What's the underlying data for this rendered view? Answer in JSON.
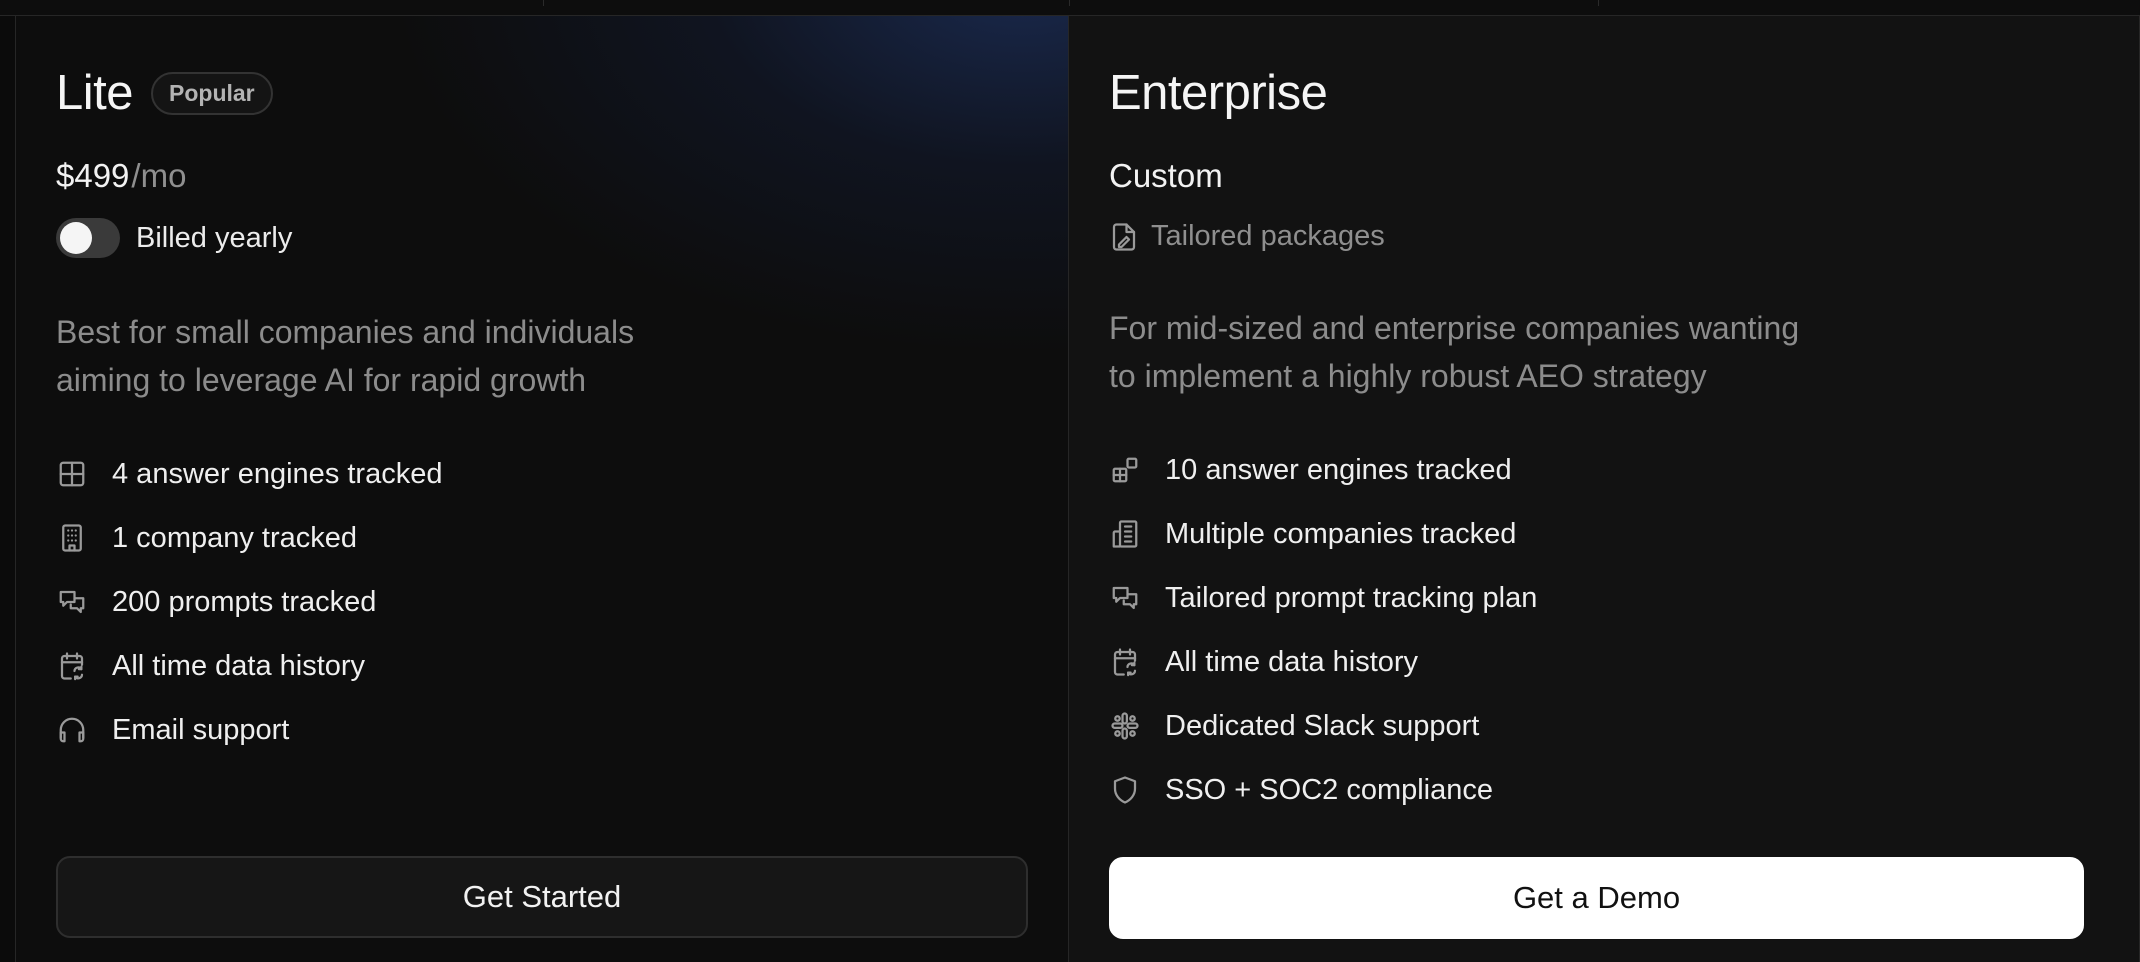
{
  "lite": {
    "title": "Lite",
    "badge": "Popular",
    "price": "$499",
    "period": "/mo",
    "toggle_label": "Billed yearly",
    "toggle_on": false,
    "description_line1": "Best for small companies and individuals",
    "description_line2": "aiming to leverage AI for rapid growth",
    "features": [
      {
        "icon": "grid-icon",
        "label": "4 answer engines tracked"
      },
      {
        "icon": "building-icon",
        "label": "1 company tracked"
      },
      {
        "icon": "chat-bubbles-icon",
        "label": "200 prompts tracked"
      },
      {
        "icon": "calendar-refresh-icon",
        "label": "All time data history"
      },
      {
        "icon": "headphones-icon",
        "label": "Email support"
      }
    ],
    "cta": "Get Started"
  },
  "enterprise": {
    "title": "Enterprise",
    "price": "Custom",
    "packages_label": "Tailored packages",
    "description_line1": "For mid-sized and enterprise companies wanting",
    "description_line2": "to implement a highly robust AEO strategy",
    "features": [
      {
        "icon": "grid-plus-icon",
        "label": "10 answer engines tracked"
      },
      {
        "icon": "buildings-icon",
        "label": "Multiple companies tracked"
      },
      {
        "icon": "chat-bubbles-icon",
        "label": "Tailored prompt tracking plan"
      },
      {
        "icon": "calendar-refresh-icon",
        "label": "All time data history"
      },
      {
        "icon": "slack-icon",
        "label": "Dedicated Slack support"
      },
      {
        "icon": "shield-icon",
        "label": "SSO + SOC2 compliance"
      }
    ],
    "cta": "Get a Demo"
  },
  "colors": {
    "background": "#0b0b0b",
    "card_lite": "#0d0d0d",
    "card_enterprise": "#121212",
    "accent_glow": "#244082",
    "muted_text": "#8c8c8c",
    "primary_cta_bg": "#ffffff"
  }
}
